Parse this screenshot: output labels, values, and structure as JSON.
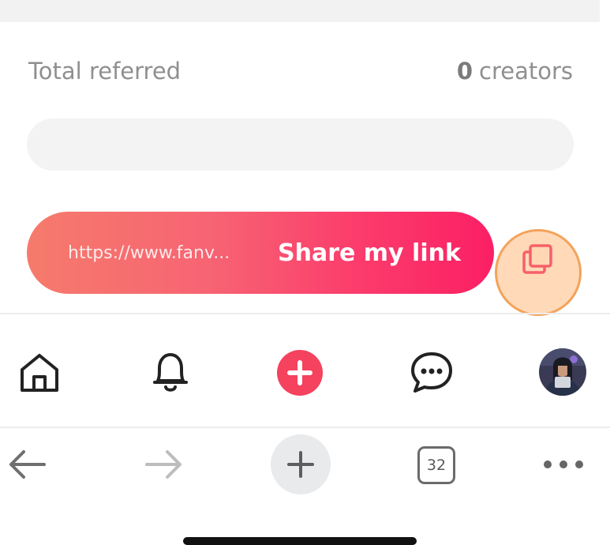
{
  "referral": {
    "label": "Total referred",
    "count": "0",
    "unit": "creators",
    "progress_fraction": 0
  },
  "share": {
    "url": "https://www.fanv...",
    "button_label": "Share my link",
    "copy_icon": "copy-icon"
  },
  "app_nav": {
    "items": [
      "home-icon",
      "bell-icon",
      "create-plus-icon",
      "chat-icon",
      "avatar"
    ],
    "accent": "#fa3c6a"
  },
  "browser_bar": {
    "tab_count": "32",
    "items": [
      "back-arrow-icon",
      "forward-arrow-icon",
      "new-tab-plus-icon",
      "tabs-icon",
      "more-icon"
    ]
  }
}
